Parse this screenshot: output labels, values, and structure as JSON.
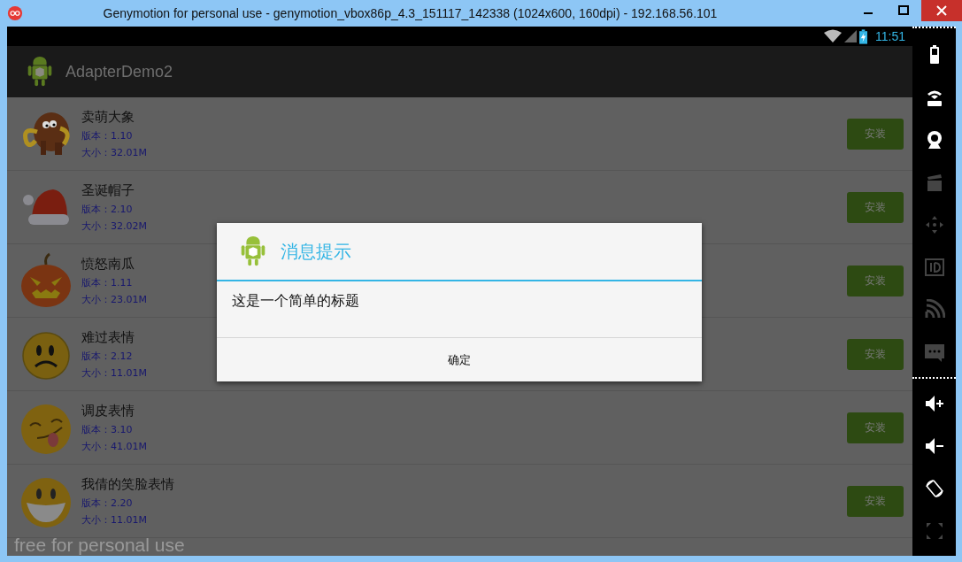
{
  "window": {
    "title": "Genymotion for personal use - genymotion_vbox86p_4.3_151117_142338 (1024x600, 160dpi) - 192.168.56.101"
  },
  "status_bar": {
    "time": "11:51"
  },
  "action_bar": {
    "title": "AdapterDemo2"
  },
  "apps": [
    {
      "name": "卖萌大象",
      "version": "版本：1.10",
      "size": "大小：32.01M",
      "button": "安装"
    },
    {
      "name": "圣诞帽子",
      "version": "版本：2.10",
      "size": "大小：32.02M",
      "button": "安装"
    },
    {
      "name": "愤怒南瓜",
      "version": "版本：1.11",
      "size": "大小：23.01M",
      "button": "安装"
    },
    {
      "name": "难过表情",
      "version": "版本：2.12",
      "size": "大小：11.01M",
      "button": "安装"
    },
    {
      "name": "调皮表情",
      "version": "版本：3.10",
      "size": "大小：41.01M",
      "button": "安装"
    },
    {
      "name": "我倩的笑脸表情",
      "version": "版本：2.20",
      "size": "大小：11.01M",
      "button": "安装"
    }
  ],
  "dialog": {
    "title": "消息提示",
    "message": "这是一个简单的标题",
    "button": "确定"
  },
  "overlay_text": "free for personal use",
  "side_panel": [
    {
      "disabled": false
    },
    {
      "disabled": false
    },
    {
      "disabled": false
    },
    {
      "disabled": true
    },
    {
      "disabled": true
    },
    {
      "disabled": true
    },
    {
      "disabled": true
    },
    {
      "disabled": true
    },
    {
      "disabled": false
    },
    {
      "disabled": false
    },
    {
      "disabled": false
    },
    {
      "disabled": true
    }
  ]
}
